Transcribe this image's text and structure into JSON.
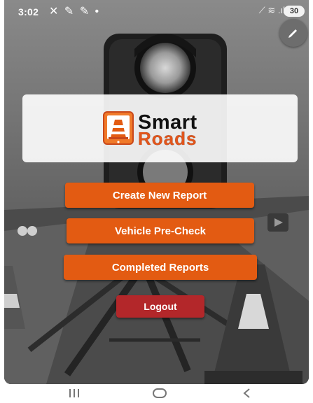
{
  "status_bar": {
    "time": "3:02",
    "left_icons": "✕ ✎ ✎ •",
    "signal_icons": "⟋ ≋ .ıl",
    "battery": "30"
  },
  "logo": {
    "word1": "Smart",
    "word2": "Roads",
    "colors": {
      "orange": "#e2551b",
      "dark": "#111111"
    }
  },
  "menu": {
    "create_label": "Create New Report",
    "precheck_label": "Vehicle Pre-Check",
    "completed_label": "Completed Reports",
    "logout_label": "Logout"
  },
  "colors": {
    "button_orange": "#e35b12",
    "logout_red": "#b3272a"
  },
  "icons": {
    "fab": "pencil-icon",
    "nav": [
      "recents-icon",
      "home-icon",
      "back-icon"
    ]
  }
}
